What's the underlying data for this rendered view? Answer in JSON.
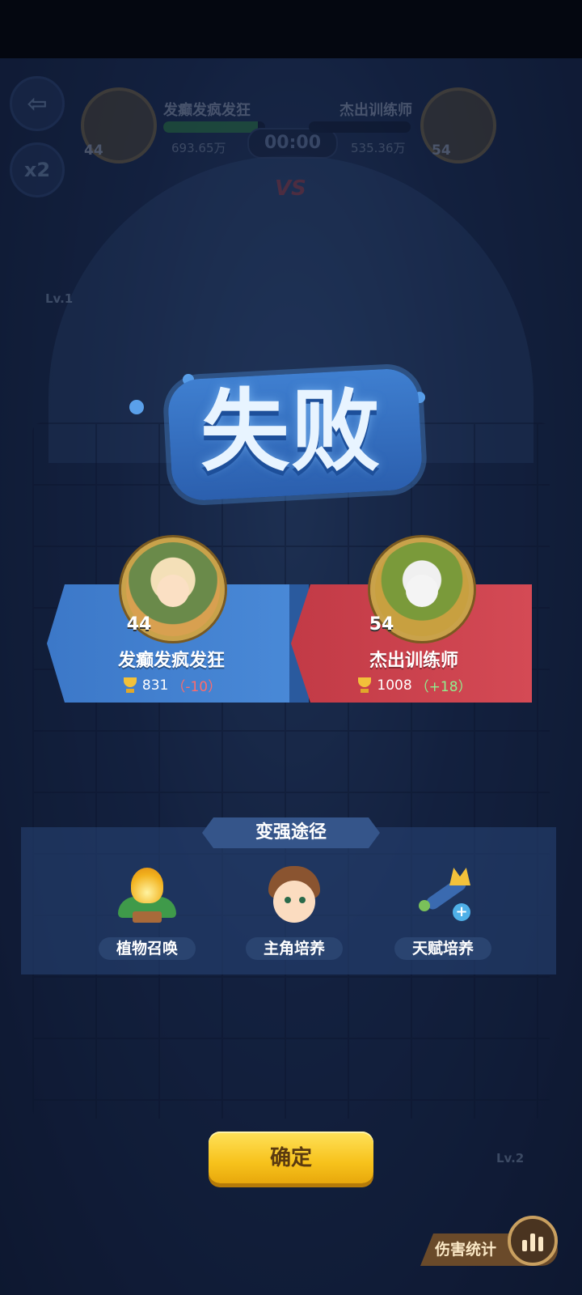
{
  "hud": {
    "timer": "00:00",
    "vs": "VS",
    "player": {
      "name": "发癫发疯发狂",
      "level": "44",
      "power": "693.65万",
      "hp_fraction": 0.93
    },
    "opponent": {
      "name": "杰出训练师",
      "level": "54",
      "power": "535.36万",
      "hp_fraction": 0.0
    },
    "speed": "x2",
    "lv_left": "Lv.1",
    "lv_right": "Lv.2"
  },
  "result": {
    "title": "失败",
    "player": {
      "name": "发癫发疯发狂",
      "level": "44",
      "trophies": "831",
      "delta": "（-10）"
    },
    "opponent": {
      "name": "杰出训练师",
      "level": "54",
      "trophies": "1008",
      "delta": "（+18）"
    }
  },
  "strengthen": {
    "header": "变强途径",
    "items": [
      {
        "label": "植物召唤",
        "icon": "plant-summon-icon"
      },
      {
        "label": "主角培养",
        "icon": "hero-training-icon"
      },
      {
        "label": "天赋培养",
        "icon": "talent-training-icon"
      }
    ]
  },
  "confirm_label": "确定",
  "damage_stats_label": "伤害统计",
  "colors": {
    "player_panel": "#3c78c8",
    "opponent_panel": "#c23a46",
    "confirm": "#f7c21c",
    "loss_delta": "#ff6b6b",
    "gain_delta": "#8ff08f"
  }
}
